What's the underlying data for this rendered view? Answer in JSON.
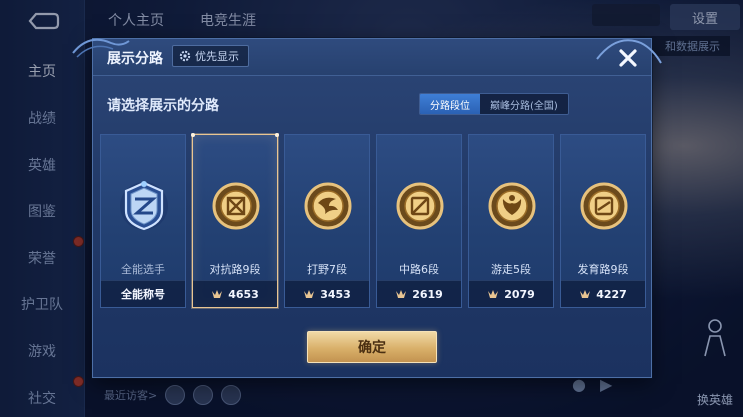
{
  "nav": {
    "items": [
      "主页",
      "战绩",
      "英雄",
      "图鉴",
      "荣誉",
      "护卫队",
      "游戏",
      "社交"
    ]
  },
  "top_tabs": [
    "个人主页",
    "电竞生涯"
  ],
  "settings_label": "设置",
  "background_strip_text": "和数据展示",
  "bottom_bar": {
    "visitors_label": "最近访客>"
  },
  "right_hero_label": "换英雄",
  "modal": {
    "title": "展示分路",
    "priority_label": "优先显示",
    "prompt": "请选择展示的分路",
    "segments": [
      {
        "label": "分路段位",
        "active": true
      },
      {
        "label": "巅峰分路(全国)",
        "active": false
      }
    ],
    "cards": [
      {
        "name": "全能选手",
        "foot": "全能称号",
        "score": "",
        "emblem": "allround-emblem-icon",
        "selected": false
      },
      {
        "name": "对抗路9段",
        "foot": "",
        "score": "4653",
        "emblem": "clash-lane-emblem-icon",
        "selected": true
      },
      {
        "name": "打野7段",
        "foot": "",
        "score": "3453",
        "emblem": "jungle-emblem-icon",
        "selected": false
      },
      {
        "name": "中路6段",
        "foot": "",
        "score": "2619",
        "emblem": "mid-lane-emblem-icon",
        "selected": false
      },
      {
        "name": "游走5段",
        "foot": "",
        "score": "2079",
        "emblem": "roam-emblem-icon",
        "selected": false
      },
      {
        "name": "发育路9段",
        "foot": "",
        "score": "4227",
        "emblem": "farm-lane-emblem-icon",
        "selected": false
      }
    ],
    "confirm_label": "确定"
  },
  "colors": {
    "accent_gold": "#e9c592",
    "segment_active": "#3f7fd6",
    "modal_bg": "#223a68"
  }
}
